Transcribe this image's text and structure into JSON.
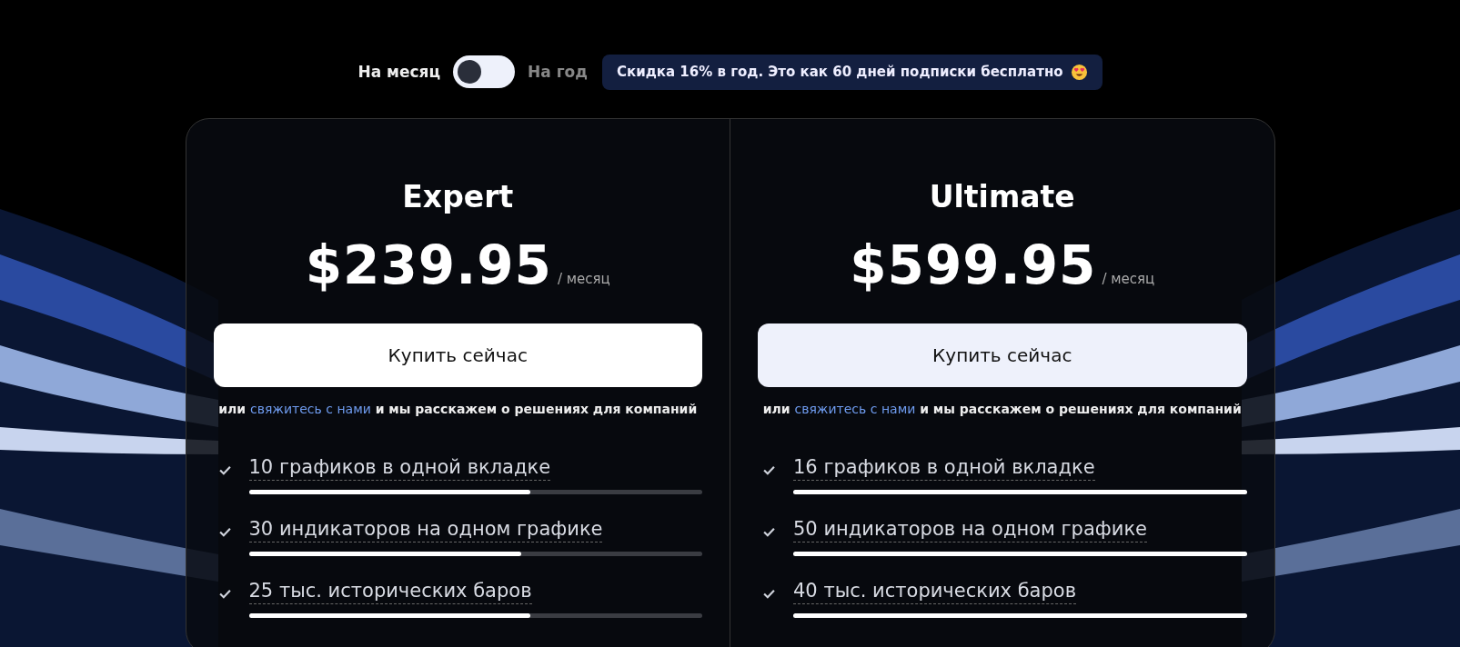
{
  "billing": {
    "options": [
      {
        "label": "На месяц",
        "selected": true
      },
      {
        "label": "На год",
        "selected": false
      }
    ],
    "switch_on": false,
    "promo": "Скидка 16% в год. Это как 60 дней подписки бесплатно"
  },
  "plans": [
    {
      "name": "Expert",
      "price": "$239.95",
      "period": "/ месяц",
      "button": {
        "label": "Купить сейчас",
        "hovered": false
      },
      "note": {
        "before": "или",
        "link": "свяжитесь с нами",
        "after": "и мы расскажем о решениях для компаний"
      },
      "features": [
        {
          "label": "10 графиков в одной вкладке",
          "level": 0.62
        },
        {
          "label": "30 индикаторов на одном графике",
          "level": 0.6
        },
        {
          "label": "25 тыс. исторических баров",
          "level": 0.62
        }
      ]
    },
    {
      "name": "Ultimate",
      "price": "$599.95",
      "period": "/ месяц",
      "button": {
        "label": "Купить сейчас",
        "hovered": true
      },
      "note": {
        "before": "или",
        "link": "свяжитесь с нами",
        "after": "и мы расскажем о решениях для компаний"
      },
      "features": [
        {
          "label": "16 графиков в одной вкладке",
          "level": 1
        },
        {
          "label": "50 индикаторов на одном графике",
          "level": 1
        },
        {
          "label": "40 тыс. исторических баров",
          "level": 1
        }
      ]
    }
  ]
}
